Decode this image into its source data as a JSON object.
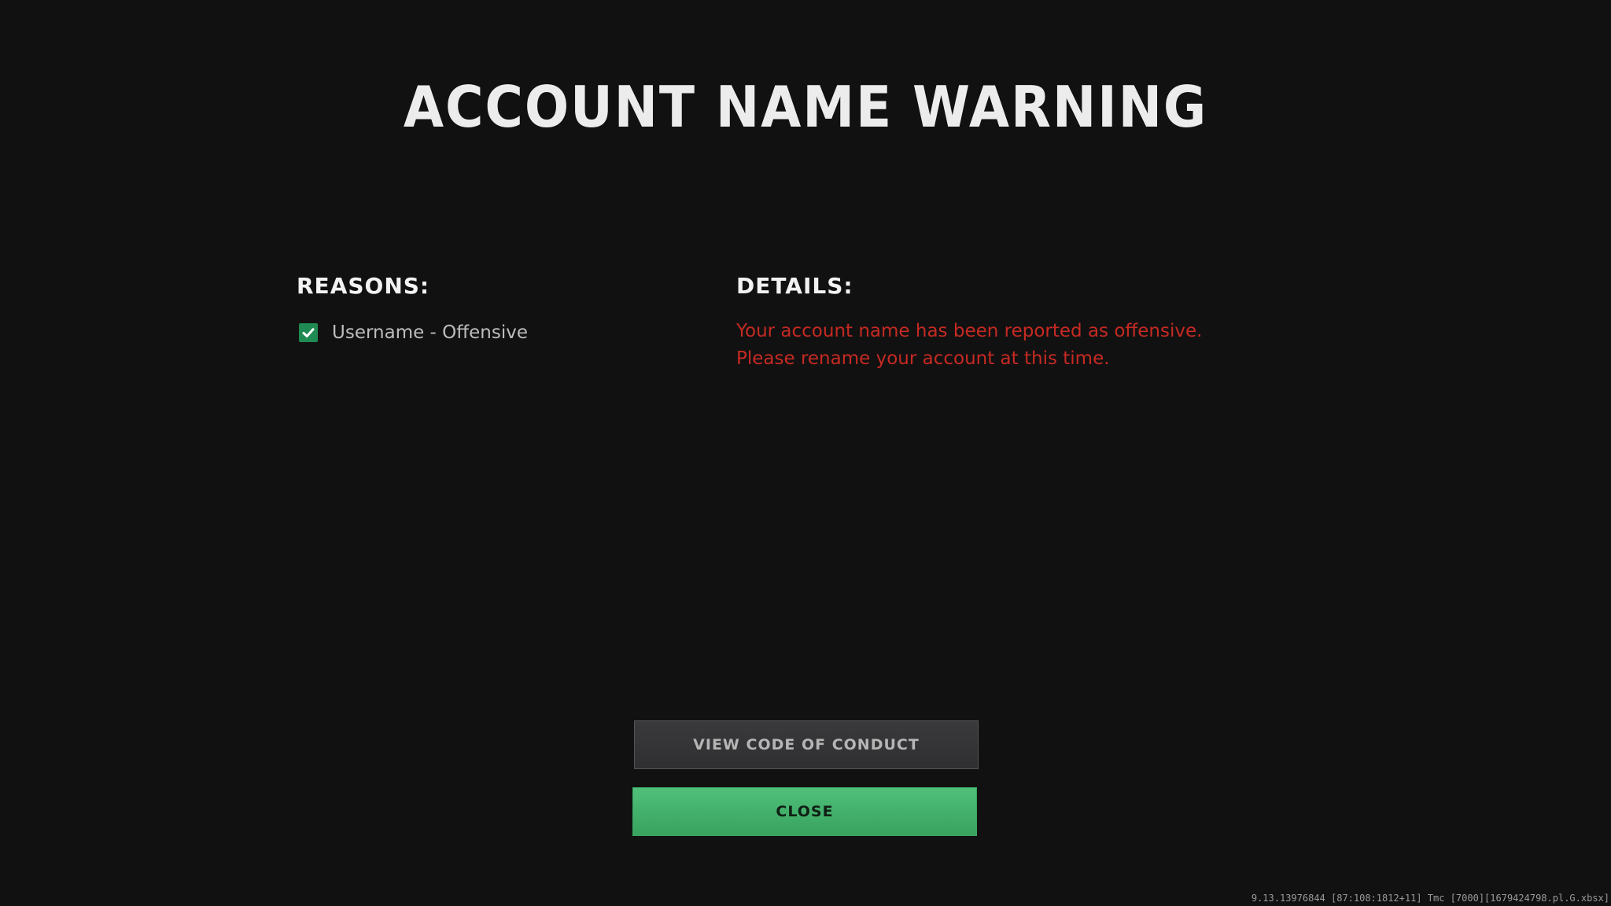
{
  "page": {
    "title": "ACCOUNT NAME WARNING"
  },
  "reasons": {
    "heading": "REASONS:",
    "items": [
      {
        "label": "Username - Offensive",
        "checked": true
      }
    ]
  },
  "details": {
    "heading": "DETAILS:",
    "text": "Your account name has been reported as offensive. Please rename your account at this time."
  },
  "buttons": {
    "view_code_label": "VIEW CODE OF CONDUCT",
    "close_label": "CLOSE"
  },
  "footer": {
    "version": "9.13.13976844 [87:108:1812+11] Tmc [7000][1679424798.pl.G.xbsx]"
  },
  "colors": {
    "background": "#111112",
    "accent_green": "#45b46c",
    "details_red": "#c62a22"
  },
  "icons": {
    "checkbox": "check-icon"
  }
}
